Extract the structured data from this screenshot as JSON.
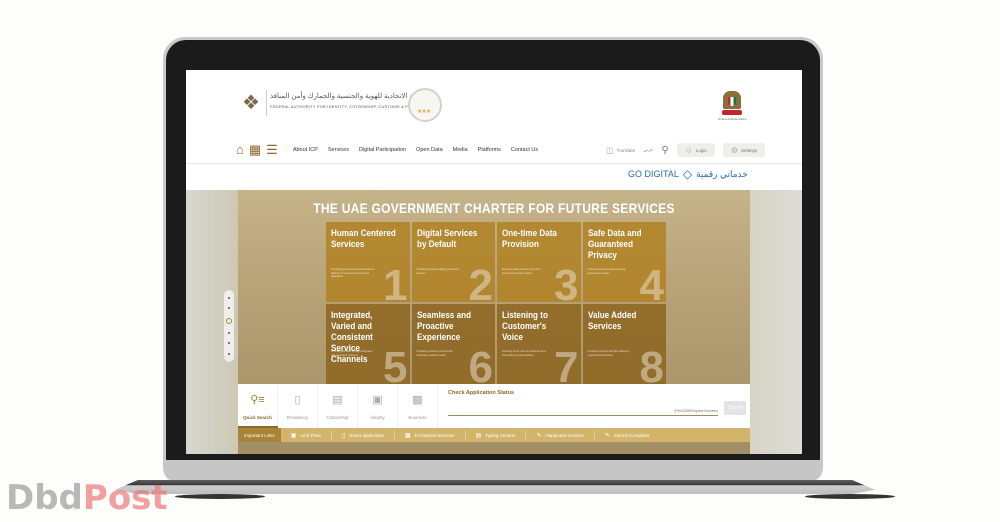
{
  "header": {
    "logo_arabic": "الهيئة الاتحادية للهوية والجنسية والجمارك وأمن المنافذ",
    "logo_english": "FEDERAL AUTHORITY FOR IDENTITY, CITIZENSHIP, CUSTOMS & PORT SECURITY",
    "emblem_label": "United Arab Emirates",
    "nav": [
      "About ICP",
      "Services",
      "Digital Participation",
      "Open Data",
      "Media",
      "Platforms",
      "Contact Us"
    ],
    "translate_label": "Translate",
    "language_label": "عربي",
    "login_label": "Login",
    "settings_label": "Settings",
    "go_digital_en": "GO DIGITAL",
    "go_digital_ar": "خدماتي رقمية"
  },
  "hero": {
    "title": "THE UAE GOVERNMENT CHARTER FOR FUTURE SERVICES",
    "tiles": [
      {
        "title": "Human Centered Services",
        "number": "1",
        "desc": "Providing government services that are tailored to meet human needs and aspirations"
      },
      {
        "title": "Digital Services by Default",
        "number": "2",
        "desc": "Providing proactive digital government services"
      },
      {
        "title": "One-time Data Provision",
        "number": "3",
        "desc": "Requiring data provision only once across government entities"
      },
      {
        "title": "Safe Data and Guaranteed Privacy",
        "number": "4",
        "desc": "Protecting the data shared among government entities"
      },
      {
        "title": "Integrated, Varied and Consistent Service Channels",
        "number": "5",
        "desc": "Providing services through integrated and consistent channels"
      },
      {
        "title": "Seamless and Proactive Experience",
        "number": "6",
        "desc": "Providing proactive services that anticipate customer needs"
      },
      {
        "title": "Listening to Customer's Voice",
        "number": "7",
        "desc": "Listening to the voice of customers and responding to their feedback"
      },
      {
        "title": "Value Added Services",
        "number": "8",
        "desc": "Providing services that offer efficiency in government services"
      }
    ]
  },
  "quick_search": {
    "tabs": [
      {
        "label": "Quick Search",
        "icon": "quick-search-icon",
        "active": true
      },
      {
        "label": "Residency",
        "icon": "residency-icon",
        "active": false
      },
      {
        "label": "Citizenship",
        "icon": "citizenship-icon",
        "active": false
      },
      {
        "label": "Identity",
        "icon": "identity-icon",
        "active": false
      },
      {
        "label": "Business",
        "icon": "business-icon",
        "active": false
      }
    ],
    "check_title": "Check Application Status",
    "input_placeholder": "(File/UDB/Request Number)",
    "check_button": "Check"
  },
  "links": {
    "heading": "Important Links",
    "items": [
      {
        "label": "UAE Pass",
        "icon": "uae-pass-icon"
      },
      {
        "label": "Smart application",
        "icon": "smartphone-icon"
      },
      {
        "label": "E-Channel Services",
        "icon": "e-channel-icon"
      },
      {
        "label": "Typing Centers",
        "icon": "typing-center-icon"
      },
      {
        "label": "Happiness Centers",
        "icon": "happiness-icon"
      },
      {
        "label": "Submit Complaint",
        "icon": "complaint-icon"
      }
    ]
  },
  "watermark": {
    "part1": "Dbd",
    "part2": "Post"
  },
  "colors": {
    "brand_gold": "#a8843a",
    "link_bar": "#d3b46b",
    "go_digital_blue": "#2a6aa8"
  }
}
